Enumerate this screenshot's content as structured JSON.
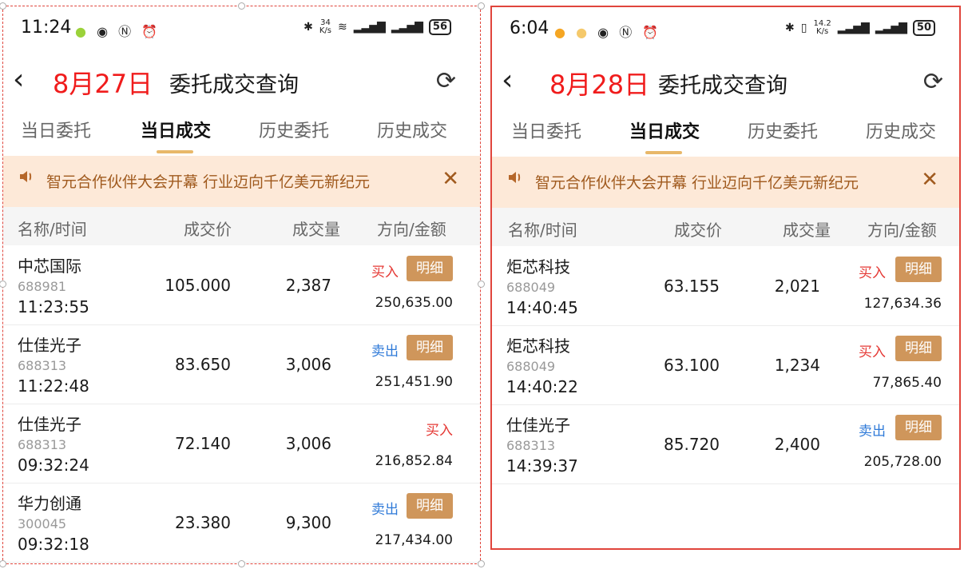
{
  "colors": {
    "accent_red": "#f01c1c",
    "buy": "#e53935",
    "sell": "#2f7ad8",
    "detail_button": "#cf965b",
    "banner_bg": "#fde9d8",
    "tab_underline": "#e8b86a"
  },
  "panels": [
    {
      "status": {
        "time": "11:24",
        "speed_value": "34",
        "speed_unit": "K/s",
        "battery": "56"
      },
      "date": "8月27日",
      "title": "委托成交查询",
      "tabs": [
        "当日委托",
        "当日成交",
        "历史委托",
        "历史成交"
      ],
      "active_tab": 1,
      "banner": "智元合作伙伴大会开幕 行业迈向千亿美元新纪元",
      "columns": [
        "名称/时间",
        "成交价",
        "成交量",
        "方向/金额"
      ],
      "rows": [
        {
          "name": "中芯国际",
          "code": "688981",
          "time": "11:23:55",
          "price": "105.000",
          "qty": "2,387",
          "direction": "买入",
          "dir_type": "buy",
          "detail": "明细",
          "amount": "250,635.00"
        },
        {
          "name": "仕佳光子",
          "code": "688313",
          "time": "11:22:48",
          "price": "83.650",
          "qty": "3,006",
          "direction": "卖出",
          "dir_type": "sell",
          "detail": "明细",
          "amount": "251,451.90"
        },
        {
          "name": "仕佳光子",
          "code": "688313",
          "time": "09:32:24",
          "price": "72.140",
          "qty": "3,006",
          "direction": "买入",
          "dir_type": "buy",
          "detail": "",
          "amount": "216,852.84"
        },
        {
          "name": "华力创通",
          "code": "300045",
          "time": "09:32:18",
          "price": "23.380",
          "qty": "9,300",
          "direction": "卖出",
          "dir_type": "sell",
          "detail": "明细",
          "amount": "217,434.00"
        }
      ]
    },
    {
      "status": {
        "time": "6:04",
        "speed_value": "14.2",
        "speed_unit": "K/s",
        "battery": "50"
      },
      "date": "8月28日",
      "title": "委托成交查询",
      "tabs": [
        "当日委托",
        "当日成交",
        "历史委托",
        "历史成交"
      ],
      "active_tab": 1,
      "banner": "智元合作伙伴大会开幕 行业迈向千亿美元新纪元",
      "columns": [
        "名称/时间",
        "成交价",
        "成交量",
        "方向/金额"
      ],
      "rows": [
        {
          "name": "炬芯科技",
          "code": "688049",
          "time": "14:40:45",
          "price": "63.155",
          "qty": "2,021",
          "direction": "买入",
          "dir_type": "buy",
          "detail": "明细",
          "amount": "127,634.36"
        },
        {
          "name": "炬芯科技",
          "code": "688049",
          "time": "14:40:22",
          "price": "63.100",
          "qty": "1,234",
          "direction": "买入",
          "dir_type": "buy",
          "detail": "明细",
          "amount": "77,865.40"
        },
        {
          "name": "仕佳光子",
          "code": "688313",
          "time": "14:39:37",
          "price": "85.720",
          "qty": "2,400",
          "direction": "卖出",
          "dir_type": "sell",
          "detail": "明细",
          "amount": "205,728.00"
        }
      ]
    }
  ]
}
